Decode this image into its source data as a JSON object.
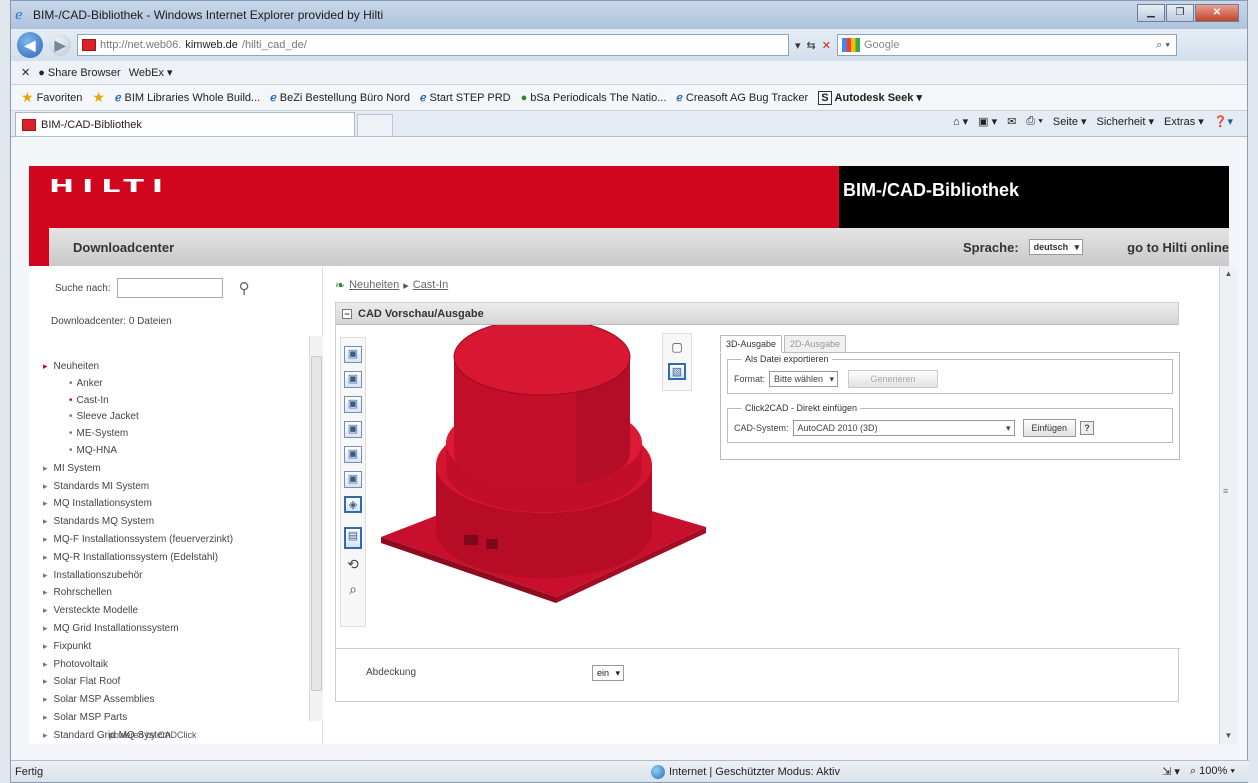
{
  "browser": {
    "window_title": "BIM-/CAD-Bibliothek - Windows Internet Explorer provided by Hilti",
    "url_prefix": "http://net.web06.",
    "url_host": "kimweb.de",
    "url_path": "/hilti_cad_de/",
    "search_placeholder": "Google",
    "toolbar2_items": [
      "Share Browser",
      "WebEx ▾"
    ],
    "favorites_label": "Favoriten",
    "favorites": [
      "BIM Libraries Whole Build...",
      "BeZi Bestellung Büro Nord",
      "Start STEP PRD",
      "bSa Periodicals The Natio...",
      "Creasoft AG Bug Tracker",
      "Autodesk Seek ▾"
    ],
    "tab_title": "BIM-/CAD-Bibliothek",
    "commands": [
      "Seite ▾",
      "Sicherheit ▾",
      "Extras ▾"
    ],
    "status_left": "Fertig",
    "status_zone": "Internet | Geschützter Modus: Aktiv",
    "zoom": "100%"
  },
  "header": {
    "logo": "HILTI",
    "site_title": "BIM-/CAD-Bibliothek",
    "section": "Downloadcenter",
    "language_label": "Sprache:",
    "language_value": "deutsch",
    "online_link": "go to Hilti online"
  },
  "sidebar": {
    "search_label": "Suche nach:",
    "download_count": "Downloadcenter: 0 Dateien",
    "tree": [
      {
        "label": "Neuheiten",
        "open": true
      },
      {
        "label": "Anker",
        "sub": true
      },
      {
        "label": "Cast-In",
        "sub": true,
        "active": true
      },
      {
        "label": "Sleeve Jacket",
        "sub": true
      },
      {
        "label": "ME-System",
        "sub": true
      },
      {
        "label": "MQ-HNA",
        "sub": true
      },
      {
        "label": "MI System"
      },
      {
        "label": "Standards MI System"
      },
      {
        "label": "MQ Installationsystem"
      },
      {
        "label": "Standards MQ System"
      },
      {
        "label": "MQ-F Installationssystem (feuerverzinkt)"
      },
      {
        "label": "MQ-R Installationssystem (Edelstahl)"
      },
      {
        "label": "Installationszubehör"
      },
      {
        "label": "Rohrschellen"
      },
      {
        "label": "Versteckte Modelle"
      },
      {
        "label": "MQ Grid Installationssystem"
      },
      {
        "label": "Fixpunkt"
      },
      {
        "label": "Photovoltaik"
      },
      {
        "label": "Solar Flat Roof"
      },
      {
        "label": "Solar MSP Assemblies"
      },
      {
        "label": "Solar MSP Parts"
      },
      {
        "label": "Standard Grid MQ System"
      }
    ],
    "powered_by": "powered by CADClick"
  },
  "breadcrumb": {
    "first": "Neuheiten",
    "second": "Cast-In"
  },
  "cad": {
    "panel_title": "CAD Vorschau/Ausgabe",
    "tab_3d": "3D-Ausgabe",
    "tab_2d": "2D-Ausgabe",
    "export_legend": "Als Datei exportieren",
    "format_label": "Format:",
    "format_value": "Bitte wählen",
    "generate_button": "Generieren",
    "click2cad_legend": "Click2CAD - Direkt einfügen",
    "cad_system_label": "CAD-System:",
    "cad_system_value": "AutoCAD 2010 (3D)",
    "insert_button": "Einfügen",
    "help": "?",
    "cover_label": "Abdeckung",
    "cover_value": "ein",
    "model_color": "#c8102e"
  }
}
